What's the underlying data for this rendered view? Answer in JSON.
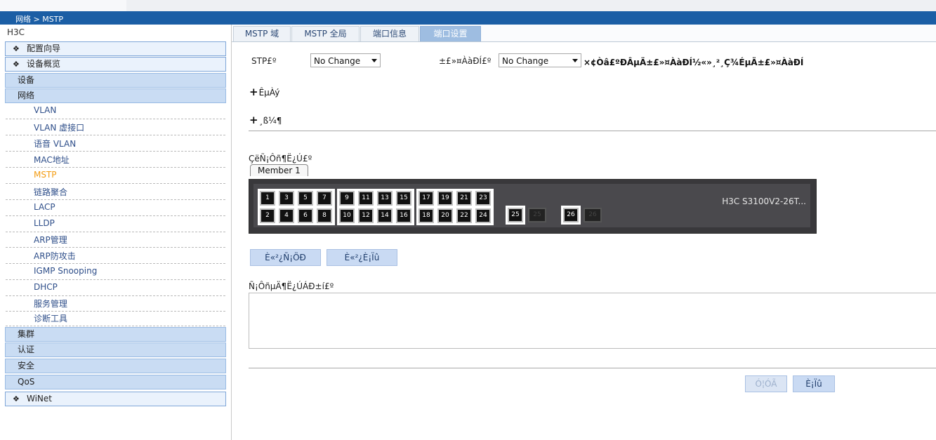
{
  "breadcrumb": "网络 > MSTP",
  "brand": "H3C",
  "sidebar": {
    "top_items": [
      {
        "label": "配置向导",
        "icon": "diamond-icon"
      },
      {
        "label": "设备概览",
        "icon": "diamond-icon"
      }
    ],
    "categories": [
      "设备",
      "网络"
    ],
    "network_items": [
      "VLAN",
      "VLAN 虚接口",
      "语音 VLAN",
      "MAC地址",
      "MSTP",
      "链路聚合",
      "LACP",
      "LLDP",
      "ARP管理",
      "ARP防攻击",
      "IGMP Snooping",
      "DHCP",
      "服务管理",
      "诊断工具"
    ],
    "active_item": "MSTP",
    "bottom_categories": [
      "集群",
      "认证",
      "安全",
      "QoS"
    ],
    "wizard_item": {
      "label": "WiNet",
      "icon": "diamond-icon"
    }
  },
  "tabs": [
    {
      "label": "MSTP 域",
      "active": false
    },
    {
      "label": "MSTP 全局",
      "active": false
    },
    {
      "label": "端口信息",
      "active": false
    },
    {
      "label": "端口设置",
      "active": true
    }
  ],
  "form": {
    "stp_label": "STP£º",
    "stp_value": "No Change",
    "protect_label": "±£»¤ÀàÐÍ£º",
    "protect_value": "No Change",
    "protect_hint": "×¢Òâ£ºÐÂµÄ±£»¤ÀàÐÍ½«»¸²¸Ç¾ÉµÄ±£»¤ÀàÐÍ",
    "expander1": "ÊµÀý",
    "expander2": "¸ß¼¶",
    "expander_icon": "plus-icon"
  },
  "port_select": {
    "label": "ÇëÑ¡Ôñ¶Ë¿Ú£º",
    "member_tab": "Member 1",
    "model": "H3C S3100V2-26T...",
    "ports_top": [
      "1",
      "3",
      "5",
      "7",
      "9",
      "11",
      "13",
      "15",
      "17",
      "19",
      "21",
      "23"
    ],
    "ports_bottom": [
      "2",
      "4",
      "6",
      "8",
      "10",
      "12",
      "14",
      "16",
      "18",
      "20",
      "22",
      "24"
    ],
    "uplinks": [
      "25",
      "26"
    ],
    "sfp_labels": [
      "25",
      "26"
    ]
  },
  "buttons": {
    "select_all": "È«²¿Ñ¡ÖÐ",
    "cancel_all": "È«²¿È¡Ïû",
    "apply": "Ó¦ÓÃ",
    "cancel": "È¡Ïû"
  },
  "selected_list_label": "Ñ¡ÔñµÄ¶Ë¿ÚÁÐ±í£º",
  "colors": {
    "header_blue": "#1b5ea5",
    "active_tab": "#9ebde1",
    "active_menu": "#f39c12",
    "button_bg": "#c9daf3"
  }
}
